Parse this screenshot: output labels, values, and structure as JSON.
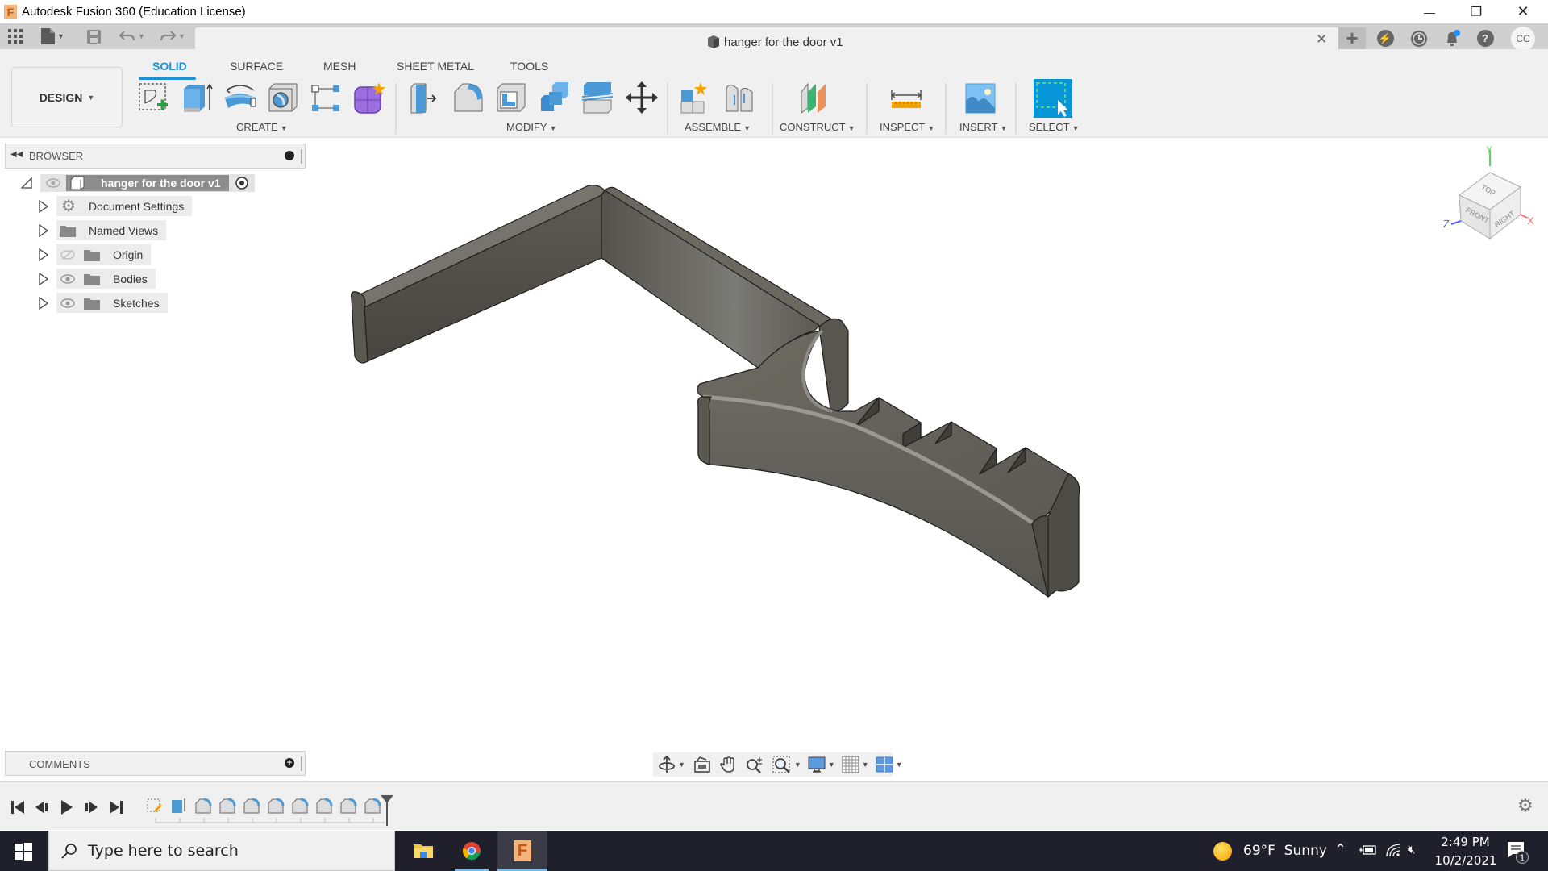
{
  "window": {
    "title": "Autodesk Fusion 360 (Education License)",
    "logo_letter": "F",
    "minimize": "—",
    "maximize": "❐",
    "close": "✕"
  },
  "quick_access": {
    "icons": [
      "apps-grid-icon",
      "file-icon",
      "save-icon",
      "undo-icon",
      "redo-icon"
    ]
  },
  "document_tab": {
    "title": "hanger for the door v1",
    "close": "✕"
  },
  "header_right": {
    "new_tab": "+",
    "avatar": "CC"
  },
  "toolbar": {
    "workspace": "DESIGN",
    "tabs": [
      {
        "label": "SOLID",
        "active": true
      },
      {
        "label": "SURFACE",
        "active": false
      },
      {
        "label": "MESH",
        "active": false
      },
      {
        "label": "SHEET METAL",
        "active": false
      },
      {
        "label": "TOOLS",
        "active": false
      }
    ],
    "groups": {
      "create": "CREATE",
      "modify": "MODIFY",
      "assemble": "ASSEMBLE",
      "construct": "CONSTRUCT",
      "inspect": "INSPECT",
      "insert": "INSERT",
      "select": "SELECT"
    }
  },
  "browser": {
    "title": "BROWSER",
    "root": "hanger for the door v1",
    "items": [
      {
        "label": "Document Settings",
        "icon": "gear-icon",
        "visible": null
      },
      {
        "label": "Named Views",
        "icon": "folder-icon",
        "visible": null
      },
      {
        "label": "Origin",
        "icon": "folder-icon",
        "visible": false
      },
      {
        "label": "Bodies",
        "icon": "folder-icon",
        "visible": true
      },
      {
        "label": "Sketches",
        "icon": "folder-icon",
        "visible": true
      }
    ]
  },
  "viewcube": {
    "top": "TOP",
    "front": "FRONT",
    "right": "RIGHT",
    "axis_x": "X",
    "axis_y": "Y",
    "axis_z": "Z"
  },
  "comments": {
    "title": "COMMENTS"
  },
  "timeline": {
    "features": [
      "sketch",
      "extrude",
      "fillet",
      "fillet",
      "fillet",
      "fillet",
      "fillet",
      "fillet",
      "fillet",
      "fillet"
    ]
  },
  "taskbar": {
    "search_placeholder": "Type here to search",
    "weather_temp": "69°F",
    "weather_desc": "Sunny",
    "time": "2:49 PM",
    "date": "10/2/2021",
    "notification_count": "1"
  }
}
